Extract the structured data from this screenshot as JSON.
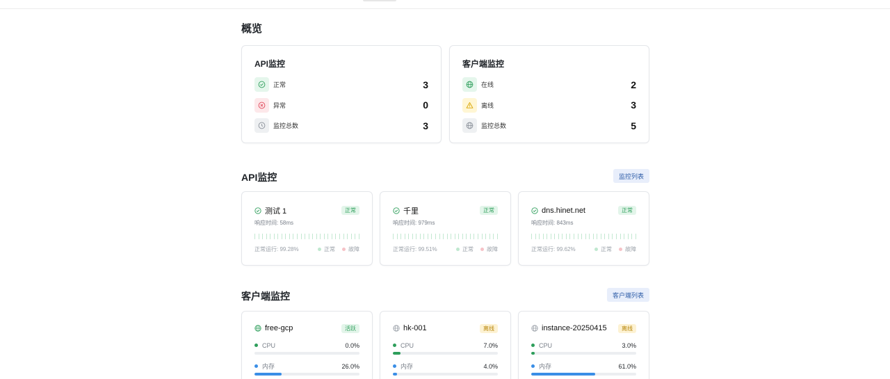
{
  "overview": {
    "title": "概览",
    "api_card": {
      "title": "API监控",
      "rows": [
        {
          "label": "正常",
          "value": "3",
          "icon": "check-circle-icon",
          "tone": "green"
        },
        {
          "label": "异常",
          "value": "0",
          "icon": "x-circle-icon",
          "tone": "red"
        },
        {
          "label": "监控总数",
          "value": "3",
          "icon": "clock-icon",
          "tone": "gray"
        }
      ]
    },
    "client_card": {
      "title": "客户端监控",
      "rows": [
        {
          "label": "在线",
          "value": "2",
          "icon": "globe-icon",
          "tone": "green"
        },
        {
          "label": "离线",
          "value": "3",
          "icon": "warning-icon",
          "tone": "yellow"
        },
        {
          "label": "监控总数",
          "value": "5",
          "icon": "globe-icon",
          "tone": "gray"
        }
      ]
    }
  },
  "api_section": {
    "title": "API监控",
    "list_button": "监控列表",
    "legend_ok": "正常",
    "legend_bad": "故障",
    "cards": [
      {
        "name": "测试 1",
        "status": "正常",
        "response": "响应时间: 58ms",
        "uptime": "正常运行: 99.28%"
      },
      {
        "name": "千里",
        "status": "正常",
        "response": "响应时间: 979ms",
        "uptime": "正常运行: 99.51%"
      },
      {
        "name": "dns.hinet.net",
        "status": "正常",
        "response": "响应时间: 843ms",
        "uptime": "正常运行: 99.62%"
      }
    ]
  },
  "client_section": {
    "title": "客户端监控",
    "list_button": "客户端列表",
    "cpu_label": "CPU",
    "mem_label": "内存",
    "cards": [
      {
        "name": "free-gcp",
        "status": "活跃",
        "status_tone": "green",
        "cpu": "0.0%",
        "cpu_pct": 0.0,
        "mem": "26.0%",
        "mem_pct": 26.0
      },
      {
        "name": "hk-001",
        "status": "离线",
        "status_tone": "yellow",
        "cpu": "7.0%",
        "cpu_pct": 7.0,
        "mem": "4.0%",
        "mem_pct": 4.0
      },
      {
        "name": "instance-20250415",
        "status": "离线",
        "status_tone": "yellow",
        "cpu": "3.0%",
        "cpu_pct": 3.0,
        "mem": "61.0%",
        "mem_pct": 61.0
      }
    ]
  },
  "colors": {
    "green": "#2e9e5b",
    "cpu_bar": "#2e9e5b",
    "mem_bar": "#3a8ee6",
    "accent_blue": "#2f5ea8"
  }
}
